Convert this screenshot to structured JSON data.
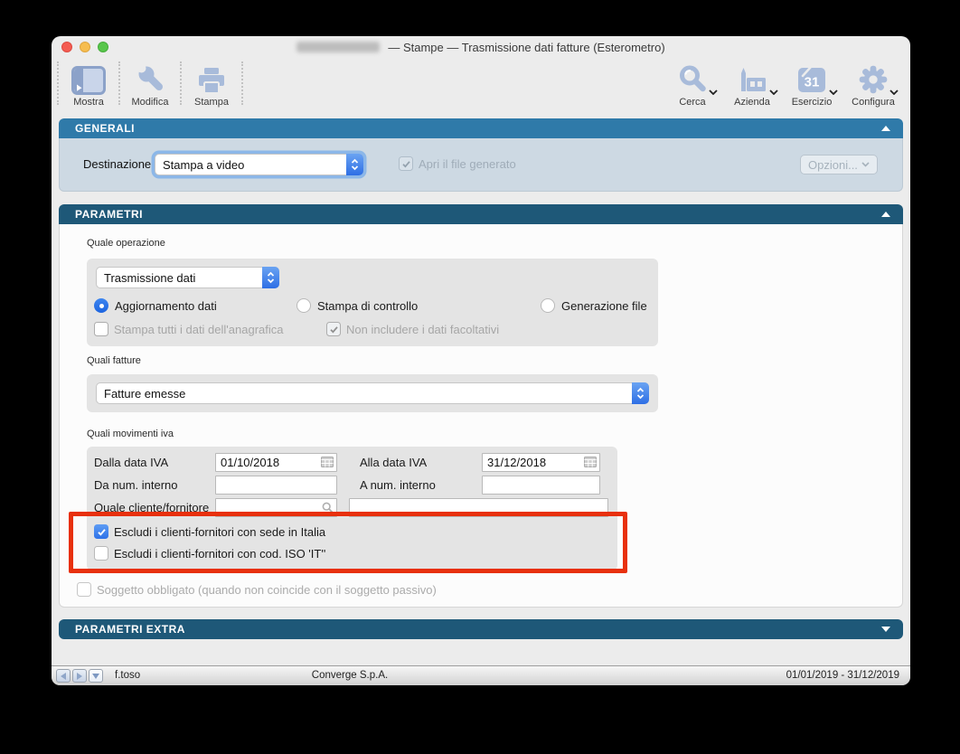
{
  "titlebar": {
    "title": "— Stampe — Trasmissione dati fatture (Esterometro)"
  },
  "toolbar": {
    "left": [
      {
        "label": "Mostra"
      },
      {
        "label": "Modifica"
      },
      {
        "label": "Stampa"
      }
    ],
    "right": [
      {
        "label": "Cerca"
      },
      {
        "label": "Azienda"
      },
      {
        "label": "Esercizio",
        "badge": "31"
      },
      {
        "label": "Configura"
      }
    ]
  },
  "generali": {
    "title": "GENERALI",
    "destinazione": {
      "label": "Destinazione",
      "value": "Stampa a video"
    },
    "apri_file": {
      "label": "Apri il file generato",
      "checked": true,
      "disabled": true
    },
    "opzioni": {
      "label": "Opzioni..."
    }
  },
  "parametri": {
    "title": "PARAMETRI",
    "quale_operazione": {
      "label": "Quale operazione",
      "select_value": "Trasmissione dati",
      "radio_options": [
        {
          "label": "Aggiornamento dati",
          "selected": true
        },
        {
          "label": "Stampa di controllo",
          "selected": false
        },
        {
          "label": "Generazione file",
          "selected": false
        }
      ],
      "checkboxes": [
        {
          "label": "Stampa tutti i dati dell'anagrafica",
          "checked": false,
          "disabled": true
        },
        {
          "label": "Non includere i dati facoltativi",
          "checked": true,
          "disabled": true
        }
      ]
    },
    "quali_fatture": {
      "label": "Quali fatture",
      "select_value": "Fatture emesse"
    },
    "quali_movimenti": {
      "label": "Quali movimenti iva",
      "dalla_data": {
        "label": "Dalla data IVA",
        "value": "01/10/2018"
      },
      "alla_data": {
        "label": "Alla data IVA",
        "value": "31/12/2018"
      },
      "da_num": {
        "label": "Da num. interno",
        "value": ""
      },
      "a_num": {
        "label": "A num. interno",
        "value": ""
      },
      "quale_cliente": {
        "label": "Quale cliente/fornitore",
        "value": "",
        "value2": ""
      },
      "escludi_sede": {
        "label": "Escludi i clienti-fornitori con sede in Italia",
        "checked": true
      },
      "escludi_iso": {
        "label": "Escludi i clienti-fornitori con cod. ISO 'IT''",
        "checked": false
      }
    },
    "soggetto": {
      "label": "Soggetto obbligato (quando non coincide con il soggetto passivo)",
      "checked": false,
      "disabled": true
    }
  },
  "parametri_extra": {
    "title": "PARAMETRI EXTRA"
  },
  "statusbar": {
    "user": "f.toso",
    "company": "Converge S.p.A.",
    "period": "01/01/2019 - 31/12/2019"
  },
  "annotations": {
    "highlight_color": "#E8300C"
  },
  "colors": {
    "header_active": "#2F7AA9",
    "header_dark": "#1E5878",
    "generali_panel": "#CDD9E3",
    "accent_blue": "#2F72E8",
    "toolbar_icon_blue": "#A8BBDA"
  }
}
